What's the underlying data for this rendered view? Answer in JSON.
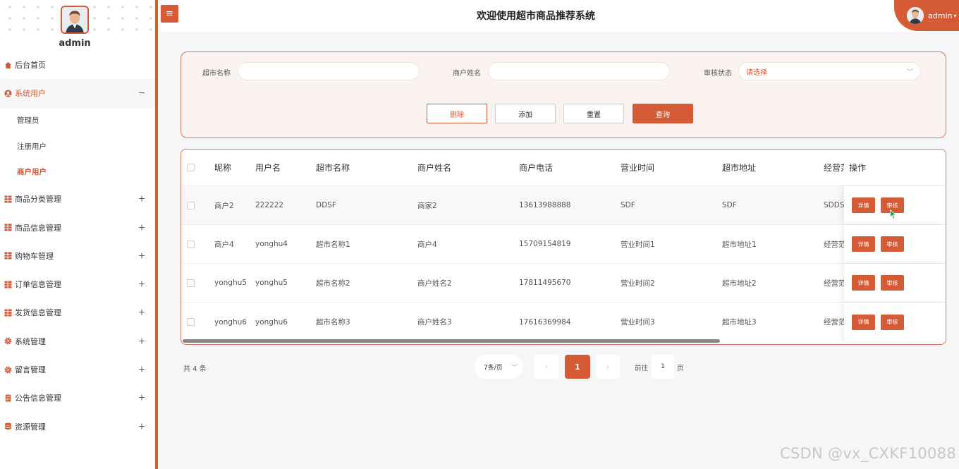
{
  "colors": {
    "accent": "#d45b36",
    "panel_bg": "#fbf3f1"
  },
  "sidebar": {
    "username": "admin",
    "menu": [
      {
        "label": "后台首页",
        "icon": "home-icon",
        "sign": ""
      },
      {
        "label": "系统用户",
        "icon": "user-circle-icon",
        "sign": "−"
      },
      {
        "label": "商品分类管理",
        "icon": "grid-icon",
        "sign": "+"
      },
      {
        "label": "商品信息管理",
        "icon": "grid-icon",
        "sign": "+"
      },
      {
        "label": "购物车管理",
        "icon": "grid-icon",
        "sign": "+"
      },
      {
        "label": "订单信息管理",
        "icon": "grid-icon",
        "sign": "+"
      },
      {
        "label": "发货信息管理",
        "icon": "grid-icon",
        "sign": "+"
      },
      {
        "label": "系统管理",
        "icon": "gear-icon",
        "sign": "+"
      },
      {
        "label": "留言管理",
        "icon": "gear-icon",
        "sign": "+"
      },
      {
        "label": "公告信息管理",
        "icon": "document-icon",
        "sign": "+"
      },
      {
        "label": "资源管理",
        "icon": "database-icon",
        "sign": "+"
      }
    ],
    "submenu": [
      "管理员",
      "注册用户",
      "商户用户"
    ]
  },
  "header": {
    "toggle_icon": "≡",
    "title": "欢迎使用超市商品推荐系统",
    "user": "admin"
  },
  "search": {
    "fields": [
      {
        "label": "超市名称",
        "value": ""
      },
      {
        "label": "商户姓名",
        "value": ""
      }
    ],
    "status_label": "审核状态",
    "status_placeholder": "请选择",
    "buttons": {
      "delete": "删除",
      "add": "添加",
      "reset": "重置",
      "query": "查询"
    }
  },
  "table": {
    "headers": [
      "昵称",
      "用户名",
      "超市名称",
      "商户姓名",
      "商户电话",
      "营业时间",
      "超市地址",
      "经营范",
      "操作"
    ],
    "rows": [
      [
        "商户2",
        "222222",
        "DDSF",
        "商家2",
        "13613988888",
        "SDF",
        "SDF",
        "SDDS"
      ],
      [
        "商户4",
        "yonghu4",
        "超市名称1",
        "商户4",
        "15709154819",
        "营业时间1",
        "超市地址1",
        "经营范"
      ],
      [
        "yonghu5",
        "yonghu5",
        "超市名称2",
        "商户姓名2",
        "17811495670",
        "营业时间2",
        "超市地址2",
        "经营范"
      ],
      [
        "yonghu6",
        "yonghu6",
        "超市名称3",
        "商户姓名3",
        "17616369984",
        "营业时间3",
        "超市地址3",
        "经营范"
      ]
    ],
    "row_buttons": {
      "detail": "详情",
      "audit": "审核"
    }
  },
  "pagination": {
    "total": "共 4 条",
    "page_size": "7条/页",
    "prev": "‹",
    "next": "›",
    "current": "1",
    "goto_prefix": "前往",
    "goto_value": "1",
    "goto_suffix": "页"
  },
  "watermark": "CSDN @vx_CXKF10088"
}
